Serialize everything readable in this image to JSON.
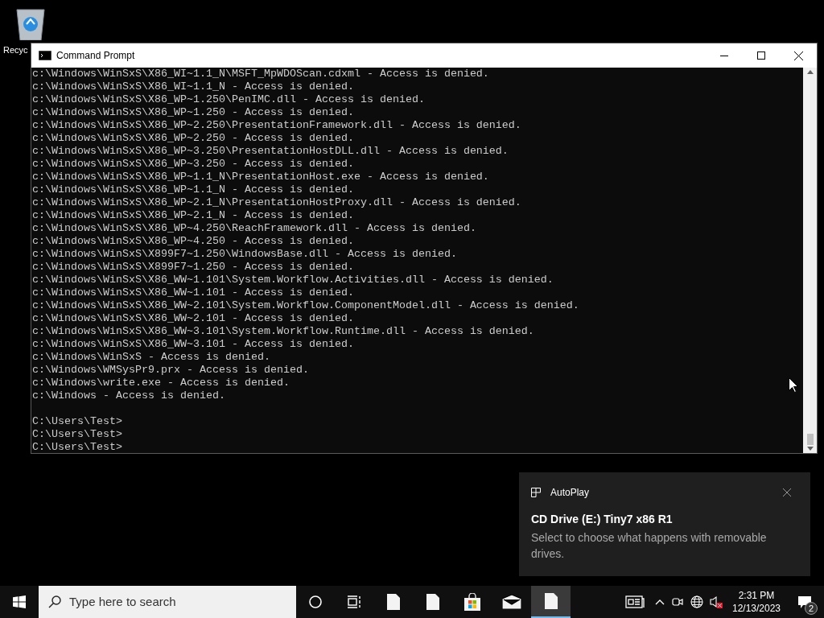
{
  "desktop": {
    "icons": [
      {
        "label": "Recyc"
      }
    ]
  },
  "window": {
    "title": "Command Prompt",
    "output_lines": [
      "c:\\Windows\\WinSxS\\X86_WI~1.1_N\\MSFT_MpWDOScan.cdxml - Access is denied.",
      "c:\\Windows\\WinSxS\\X86_WI~1.1_N - Access is denied.",
      "c:\\Windows\\WinSxS\\X86_WP~1.250\\PenIMC.dll - Access is denied.",
      "c:\\Windows\\WinSxS\\X86_WP~1.250 - Access is denied.",
      "c:\\Windows\\WinSxS\\X86_WP~2.250\\PresentationFramework.dll - Access is denied.",
      "c:\\Windows\\WinSxS\\X86_WP~2.250 - Access is denied.",
      "c:\\Windows\\WinSxS\\X86_WP~3.250\\PresentationHostDLL.dll - Access is denied.",
      "c:\\Windows\\WinSxS\\X86_WP~3.250 - Access is denied.",
      "c:\\Windows\\WinSxS\\X86_WP~1.1_N\\PresentationHost.exe - Access is denied.",
      "c:\\Windows\\WinSxS\\X86_WP~1.1_N - Access is denied.",
      "c:\\Windows\\WinSxS\\X86_WP~2.1_N\\PresentationHostProxy.dll - Access is denied.",
      "c:\\Windows\\WinSxS\\X86_WP~2.1_N - Access is denied.",
      "c:\\Windows\\WinSxS\\X86_WP~4.250\\ReachFramework.dll - Access is denied.",
      "c:\\Windows\\WinSxS\\X86_WP~4.250 - Access is denied.",
      "c:\\Windows\\WinSxS\\X899F7~1.250\\WindowsBase.dll - Access is denied.",
      "c:\\Windows\\WinSxS\\X899F7~1.250 - Access is denied.",
      "c:\\Windows\\WinSxS\\X86_WW~1.101\\System.Workflow.Activities.dll - Access is denied.",
      "c:\\Windows\\WinSxS\\X86_WW~1.101 - Access is denied.",
      "c:\\Windows\\WinSxS\\X86_WW~2.101\\System.Workflow.ComponentModel.dll - Access is denied.",
      "c:\\Windows\\WinSxS\\X86_WW~2.101 - Access is denied.",
      "c:\\Windows\\WinSxS\\X86_WW~3.101\\System.Workflow.Runtime.dll - Access is denied.",
      "c:\\Windows\\WinSxS\\X86_WW~3.101 - Access is denied.",
      "c:\\Windows\\WinSxS - Access is denied.",
      "c:\\Windows\\WMSysPr9.prx - Access is denied.",
      "c:\\Windows\\write.exe - Access is denied.",
      "c:\\Windows - Access is denied."
    ],
    "prompt_lines": [
      "C:\\Users\\Test>",
      "C:\\Users\\Test>",
      "C:\\Users\\Test>"
    ]
  },
  "toast": {
    "app": "AutoPlay",
    "title": "CD Drive (E:) Tiny7 x86 R1",
    "body": "Select to choose what happens with removable drives."
  },
  "taskbar": {
    "search": {
      "placeholder": "Type here to search"
    },
    "apps": [
      {
        "kind": "file",
        "selected": false
      },
      {
        "kind": "file",
        "selected": false
      },
      {
        "kind": "store",
        "selected": false
      },
      {
        "kind": "mail",
        "selected": false
      },
      {
        "kind": "file",
        "selected": true
      }
    ],
    "time": "2:31 PM",
    "date": "12/13/2023",
    "notification_count": "2"
  }
}
